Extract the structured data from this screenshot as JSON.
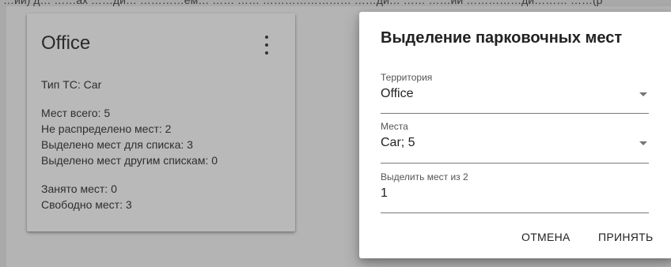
{
  "background_text": "…ий) д… ……ах ……ди… …………ем… …… …… …………………… ……ди… …… ……ий ……………ди……… ……(р",
  "card": {
    "title": "Office",
    "vehicle_type": "Тип ТС: Car",
    "total": "Мест всего: 5",
    "unallocated": "Не распределено мест: 2",
    "allocated_list": "Выделено мест для списка: 3",
    "allocated_other": "Выделено мест другим спискам: 0",
    "occupied": "Занято мест: 0",
    "free": "Свободно мест: 3"
  },
  "dialog": {
    "title": "Выделение парковочных мест",
    "territory": {
      "label": "Территория",
      "value": "Office"
    },
    "places": {
      "label": "Места",
      "value": "Car; 5"
    },
    "allocate": {
      "label": "Выделить мест из 2",
      "value": "1"
    },
    "cancel_label": "ОТМЕНА",
    "accept_label": "ПРИНЯТЬ"
  },
  "colors": {
    "overlay": "#a9a9a9",
    "card": "#b9b9b9",
    "dialog": "#ffffff"
  },
  "icons": {
    "card_menu": "more-vert-icon",
    "dropdown": "arrow-drop-down-icon"
  }
}
